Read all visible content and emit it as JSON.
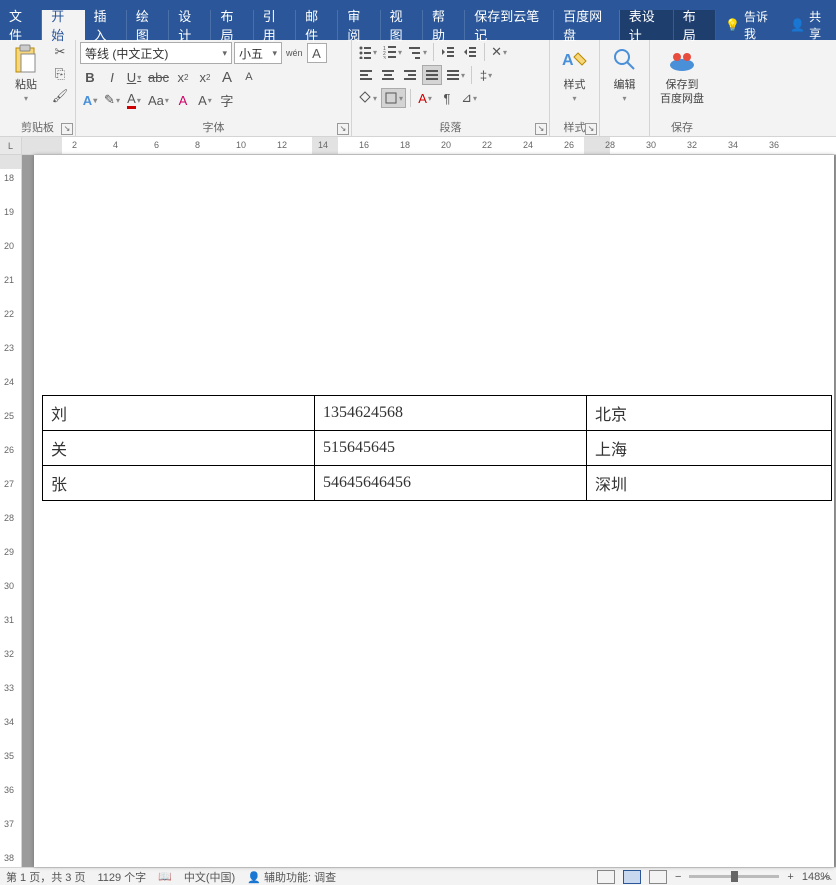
{
  "tabs": {
    "file": "文件",
    "home": "开始",
    "insert": "插入",
    "draw": "绘图",
    "design": "设计",
    "layout": "布局",
    "references": "引用",
    "mail": "邮件",
    "review": "审阅",
    "view": "视图",
    "help": "帮助",
    "cloud": "保存到云笔记",
    "baidu": "百度网盘",
    "table_design": "表设计",
    "table_layout": "布局",
    "tell_me": "告诉我",
    "share": "共享"
  },
  "ribbon": {
    "clipboard": {
      "label": "剪贴板",
      "paste": "粘贴"
    },
    "font": {
      "label": "字体",
      "name": "等线 (中文正文)",
      "size": "小五",
      "A_grow": "A",
      "A_shrink": "A",
      "Aa": "Aa",
      "clear": "A",
      "phonetic": "wén",
      "charborder": "A",
      "B": "B",
      "I": "I",
      "U": "U",
      "S": "abc",
      "x2": "x",
      "x2sup": "2",
      "x2sub": "2",
      "highlight": "A",
      "fontcolor": "A",
      "circled": "A",
      "boxed": "字"
    },
    "para": {
      "label": "段落"
    },
    "styles": {
      "label": "样式",
      "btn": "样式"
    },
    "edit": {
      "label": "",
      "btn": "编辑"
    },
    "save": {
      "label": "保存",
      "btn1": "保存到",
      "btn2": "百度网盘"
    }
  },
  "table": {
    "rows": [
      {
        "c1": "刘",
        "c2": "1354624568",
        "c3": "北京"
      },
      {
        "c1": "关",
        "c2": "515645645",
        "c3": "上海"
      },
      {
        "c1": "张",
        "c2": "54645646456",
        "c3": "深圳"
      }
    ]
  },
  "ruler": {
    "corner": "L",
    "ticks": [
      2,
      4,
      6,
      8,
      10,
      12,
      14,
      16,
      18,
      20,
      22,
      24,
      26,
      28,
      30,
      32,
      34,
      36
    ],
    "vticks": [
      18,
      19,
      20,
      21,
      22,
      23,
      24,
      25,
      26,
      27,
      28,
      29,
      30,
      31,
      32,
      33,
      34,
      35,
      36,
      37,
      38
    ]
  },
  "status": {
    "page": "第 1 页，共 3 页",
    "words": "1129 个字",
    "lang": "中文(中国)",
    "access": "辅助功能: 调查",
    "zoom": "148%",
    "minus": "−",
    "plus": "+"
  }
}
